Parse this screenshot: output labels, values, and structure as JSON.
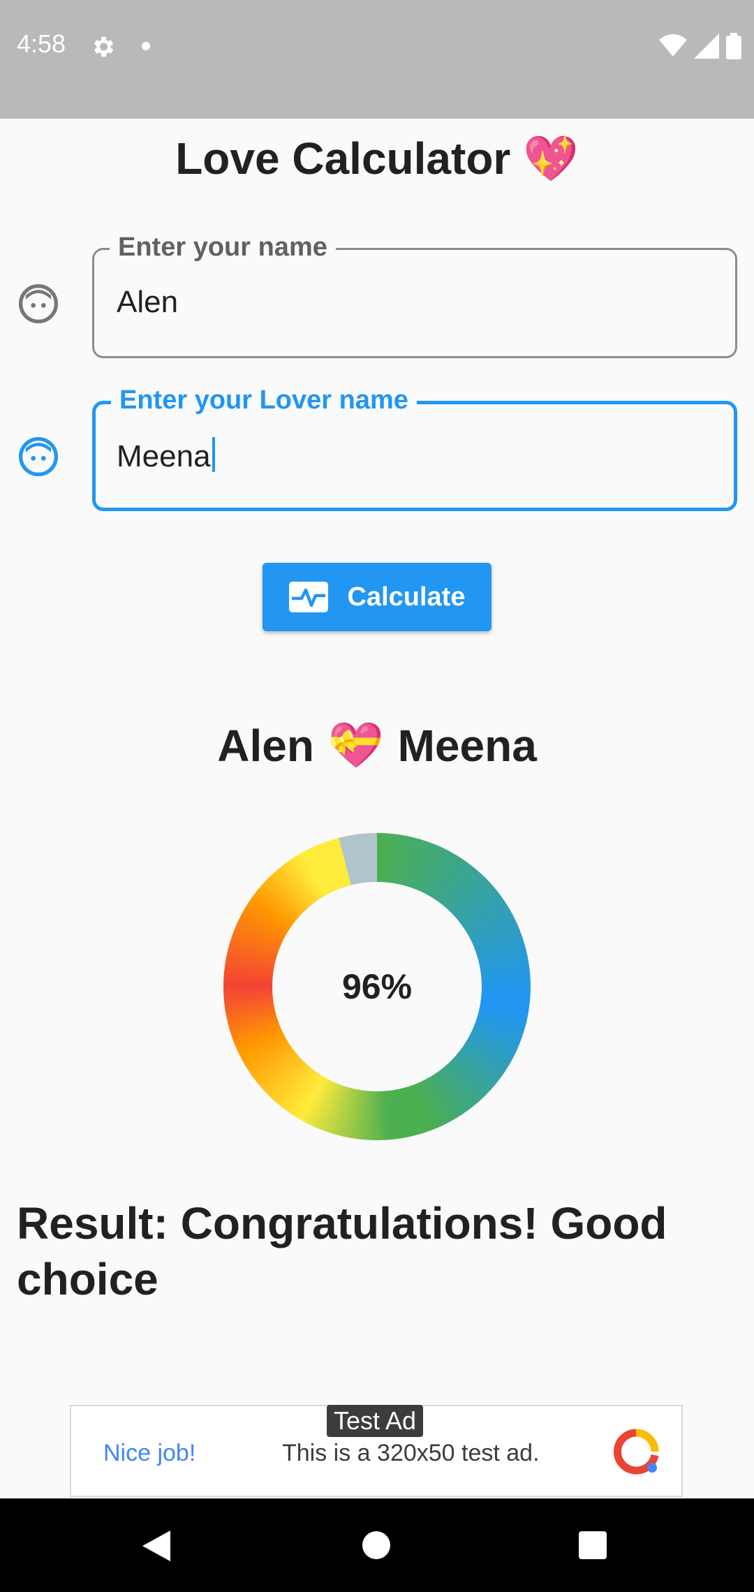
{
  "status_bar": {
    "time": "4:58"
  },
  "app": {
    "title": "Love Calculator",
    "title_emoji": "💖"
  },
  "form": {
    "name_label": "Enter your name",
    "name_value": "Alen",
    "lover_label": "Enter your Lover name",
    "lover_value": "Meena",
    "calculate_label": "Calculate"
  },
  "result": {
    "name1": "Alen",
    "heart_emoji": "💝",
    "name2": "Meena",
    "percentage": 96,
    "percentage_text": "96%",
    "message": "Result: Congratulations! Good choice"
  },
  "ad": {
    "tag": "Test Ad",
    "nice": "Nice job!",
    "text": "This is a 320x50 test ad."
  },
  "colors": {
    "accent": "#2196f3",
    "text": "#212121",
    "status_bar": "#b9b9b9"
  },
  "icons": [
    "settings-gear-icon",
    "wifi-icon",
    "signal-icon",
    "battery-icon",
    "face-icon",
    "activity-pulse-icon",
    "back-icon",
    "home-icon",
    "recents-icon"
  ]
}
